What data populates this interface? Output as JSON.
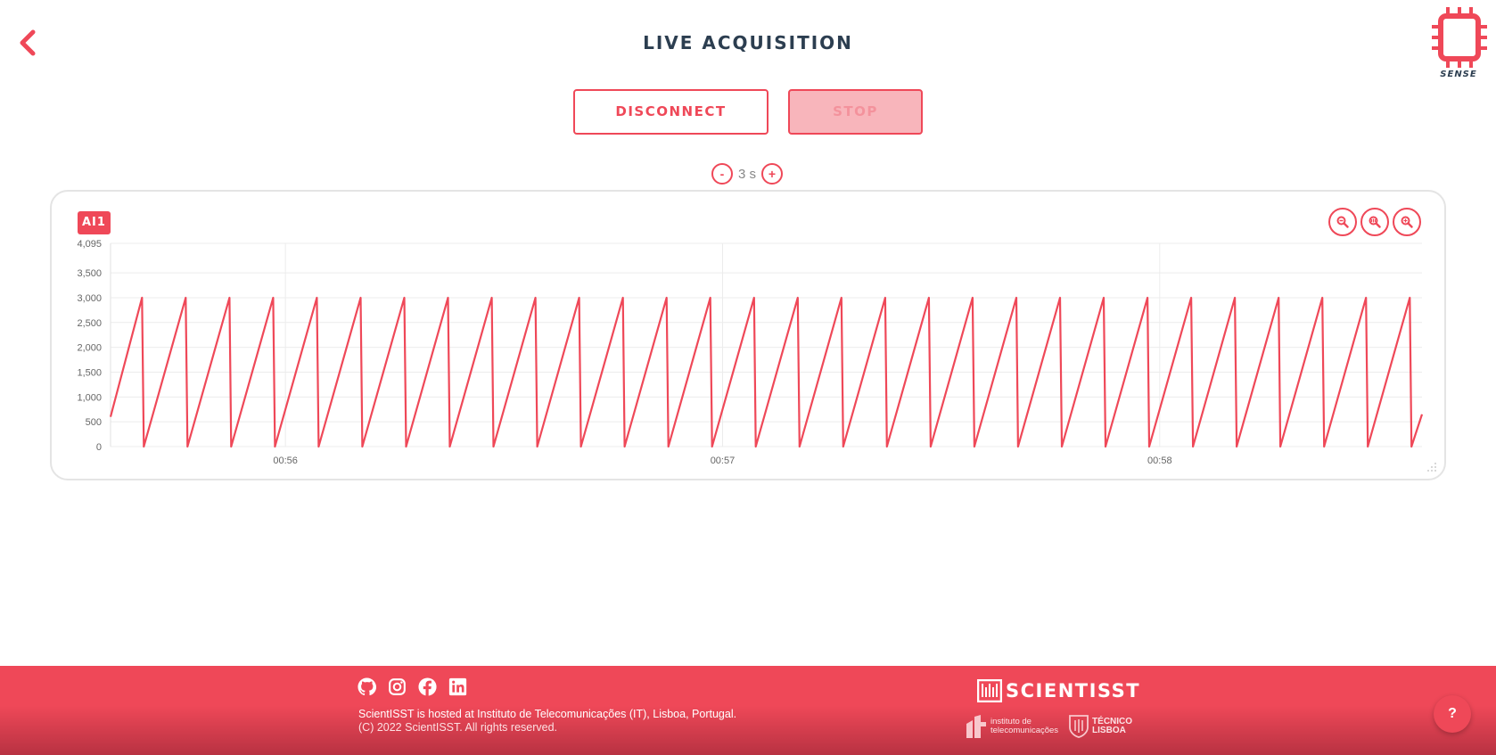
{
  "header": {
    "title": "LIVE ACQUISITION",
    "back_icon": "chevron-left-icon",
    "logo_text": "SENSE"
  },
  "controls": {
    "disconnect_label": "DISCONNECT",
    "stop_label": "STOP",
    "decrease_label": "-",
    "increase_label": "+",
    "window_label": "3 s"
  },
  "chart_data": {
    "type": "line",
    "channel": "AI1",
    "ylim": [
      0,
      4095
    ],
    "y_ticks": [
      "4,095",
      "3,500",
      "3,000",
      "2,500",
      "2,000",
      "1,500",
      "1,000",
      "500",
      "0"
    ],
    "y_tick_values": [
      4095,
      3500,
      3000,
      2500,
      2000,
      1500,
      1000,
      500,
      0
    ],
    "x_ticks": [
      "00:56",
      "00:57",
      "00:58"
    ],
    "x_tick_seconds": [
      56,
      57,
      58
    ],
    "x_range_seconds": [
      55.6,
      58.6
    ],
    "waveform": "sawtooth",
    "sawtooth_period_seconds": 0.1,
    "sawtooth_min": 0,
    "sawtooth_max": 3000,
    "first_peak_seconds": 55.672,
    "start_value": 600,
    "end_value": 650,
    "grid": true,
    "series_color": "#ef4858"
  },
  "zoom": {
    "zoom_out_icon": "zoom-out-icon",
    "zoom_reset_icon": "zoom-reset-icon",
    "zoom_in_icon": "zoom-in-icon"
  },
  "footer": {
    "social_icons": [
      "github-icon",
      "instagram-icon",
      "facebook-icon",
      "linkedin-icon"
    ],
    "hosted_text": "ScientISST is hosted at Instituto de Telecomunicações (IT), Lisboa, Portugal.",
    "copyright_text": "(C) 2022 ScientISST. All rights reserved.",
    "brand_name": "SCIENTISST",
    "partner_it_line1": "instituto de",
    "partner_it_line2": "telecomunicações",
    "partner_tecnico_line1": "TÉCNICO",
    "partner_tecnico_line2": "LISBOA"
  },
  "help_label": "?",
  "colors": {
    "accent": "#ef4858",
    "title": "#2c3e50"
  }
}
